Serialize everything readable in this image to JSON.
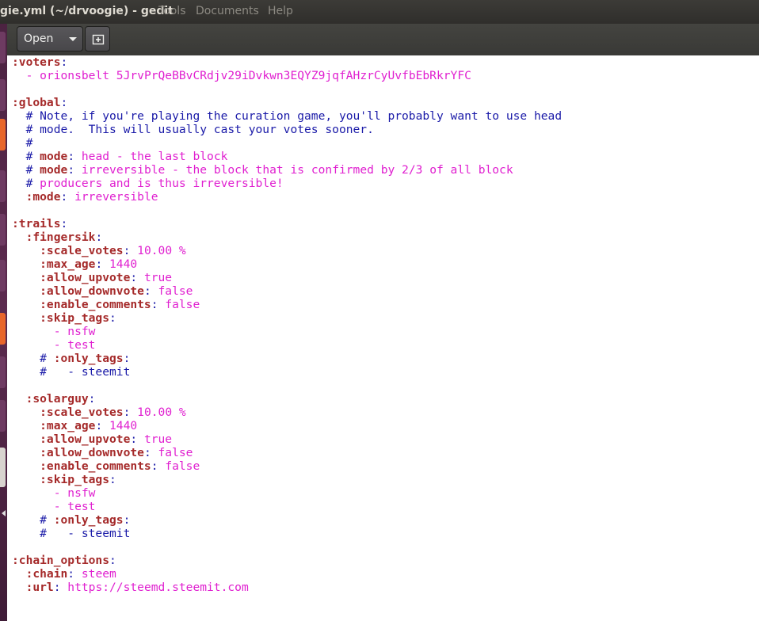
{
  "window": {
    "title": "gie.yml (~/drvoogie) - gedit",
    "menu": [
      "Tools",
      "Documents",
      "Help"
    ]
  },
  "toolbar": {
    "open_label": "Open"
  },
  "editor": {
    "lines": [
      [
        {
          "t": ":voters",
          "s": "k"
        },
        {
          "t": ":",
          "s": "p"
        }
      ],
      [
        {
          "t": "  - ",
          "s": "d"
        },
        {
          "t": "orionsbelt 5JrvPrQeBBvCRdjv29iDvkwn3EQYZ9jqfAHzrCyUvfbEbRkrYFC",
          "s": "v"
        }
      ],
      [],
      [
        {
          "t": ":global",
          "s": "k"
        },
        {
          "t": ":",
          "s": "p"
        }
      ],
      [
        {
          "t": "  # Note, if you're playing the curation game, you'll probably want to use head",
          "s": "c"
        }
      ],
      [
        {
          "t": "  # mode.  This will usually cast your votes sooner.",
          "s": "c"
        }
      ],
      [
        {
          "t": "  #",
          "s": "c"
        }
      ],
      [
        {
          "t": "  # ",
          "s": "c"
        },
        {
          "t": "mode",
          "s": "k"
        },
        {
          "t": ": ",
          "s": "p"
        },
        {
          "t": "head - the last block",
          "s": "v"
        }
      ],
      [
        {
          "t": "  # ",
          "s": "c"
        },
        {
          "t": "mode",
          "s": "k"
        },
        {
          "t": ": ",
          "s": "p"
        },
        {
          "t": "irreversible - the block that is confirmed by 2/3 of all block",
          "s": "v"
        }
      ],
      [
        {
          "t": "  # ",
          "s": "c"
        },
        {
          "t": "producers and is thus irreversible!",
          "s": "v"
        }
      ],
      [
        {
          "t": "  :mode",
          "s": "k"
        },
        {
          "t": ": ",
          "s": "p"
        },
        {
          "t": "irreversible",
          "s": "v"
        }
      ],
      [],
      [
        {
          "t": ":trails",
          "s": "k"
        },
        {
          "t": ":",
          "s": "p"
        }
      ],
      [
        {
          "t": "  :fingersik",
          "s": "k"
        },
        {
          "t": ":",
          "s": "p"
        }
      ],
      [
        {
          "t": "    :scale_votes",
          "s": "k"
        },
        {
          "t": ": ",
          "s": "p"
        },
        {
          "t": "10.00 %",
          "s": "v"
        }
      ],
      [
        {
          "t": "    :max_age",
          "s": "k"
        },
        {
          "t": ": ",
          "s": "p"
        },
        {
          "t": "1440",
          "s": "v"
        }
      ],
      [
        {
          "t": "    :allow_upvote",
          "s": "k"
        },
        {
          "t": ": ",
          "s": "p"
        },
        {
          "t": "true",
          "s": "v"
        }
      ],
      [
        {
          "t": "    :allow_downvote",
          "s": "k"
        },
        {
          "t": ": ",
          "s": "p"
        },
        {
          "t": "false",
          "s": "v"
        }
      ],
      [
        {
          "t": "    :enable_comments",
          "s": "k"
        },
        {
          "t": ": ",
          "s": "p"
        },
        {
          "t": "false",
          "s": "v"
        }
      ],
      [
        {
          "t": "    :skip_tags",
          "s": "k"
        },
        {
          "t": ":",
          "s": "p"
        }
      ],
      [
        {
          "t": "      - ",
          "s": "d"
        },
        {
          "t": "nsfw",
          "s": "v"
        }
      ],
      [
        {
          "t": "      - ",
          "s": "d"
        },
        {
          "t": "test",
          "s": "v"
        }
      ],
      [
        {
          "t": "    # ",
          "s": "c"
        },
        {
          "t": ":only_tags",
          "s": "k"
        },
        {
          "t": ":",
          "s": "p"
        }
      ],
      [
        {
          "t": "    #   - steemit",
          "s": "c"
        }
      ],
      [],
      [
        {
          "t": "  :solarguy",
          "s": "k"
        },
        {
          "t": ":",
          "s": "p"
        }
      ],
      [
        {
          "t": "    :scale_votes",
          "s": "k"
        },
        {
          "t": ": ",
          "s": "p"
        },
        {
          "t": "10.00 %",
          "s": "v"
        }
      ],
      [
        {
          "t": "    :max_age",
          "s": "k"
        },
        {
          "t": ": ",
          "s": "p"
        },
        {
          "t": "1440",
          "s": "v"
        }
      ],
      [
        {
          "t": "    :allow_upvote",
          "s": "k"
        },
        {
          "t": ": ",
          "s": "p"
        },
        {
          "t": "true",
          "s": "v"
        }
      ],
      [
        {
          "t": "    :allow_downvote",
          "s": "k"
        },
        {
          "t": ": ",
          "s": "p"
        },
        {
          "t": "false",
          "s": "v"
        }
      ],
      [
        {
          "t": "    :enable_comments",
          "s": "k"
        },
        {
          "t": ": ",
          "s": "p"
        },
        {
          "t": "false",
          "s": "v"
        }
      ],
      [
        {
          "t": "    :skip_tags",
          "s": "k"
        },
        {
          "t": ":",
          "s": "p"
        }
      ],
      [
        {
          "t": "      - ",
          "s": "d"
        },
        {
          "t": "nsfw",
          "s": "v"
        }
      ],
      [
        {
          "t": "      - ",
          "s": "d"
        },
        {
          "t": "test",
          "s": "v"
        }
      ],
      [
        {
          "t": "    # ",
          "s": "c"
        },
        {
          "t": ":only_tags",
          "s": "k"
        },
        {
          "t": ":",
          "s": "p"
        }
      ],
      [
        {
          "t": "    #   - steemit",
          "s": "c"
        }
      ],
      [],
      [
        {
          "t": ":chain_options",
          "s": "k"
        },
        {
          "t": ":",
          "s": "p"
        }
      ],
      [
        {
          "t": "  :chain",
          "s": "k"
        },
        {
          "t": ": ",
          "s": "p"
        },
        {
          "t": "steem",
          "s": "v"
        }
      ],
      [
        {
          "t": "  :url",
          "s": "k"
        },
        {
          "t": ": ",
          "s": "p"
        },
        {
          "t": "https://steemd.steemit.com",
          "s": "v"
        }
      ]
    ]
  }
}
